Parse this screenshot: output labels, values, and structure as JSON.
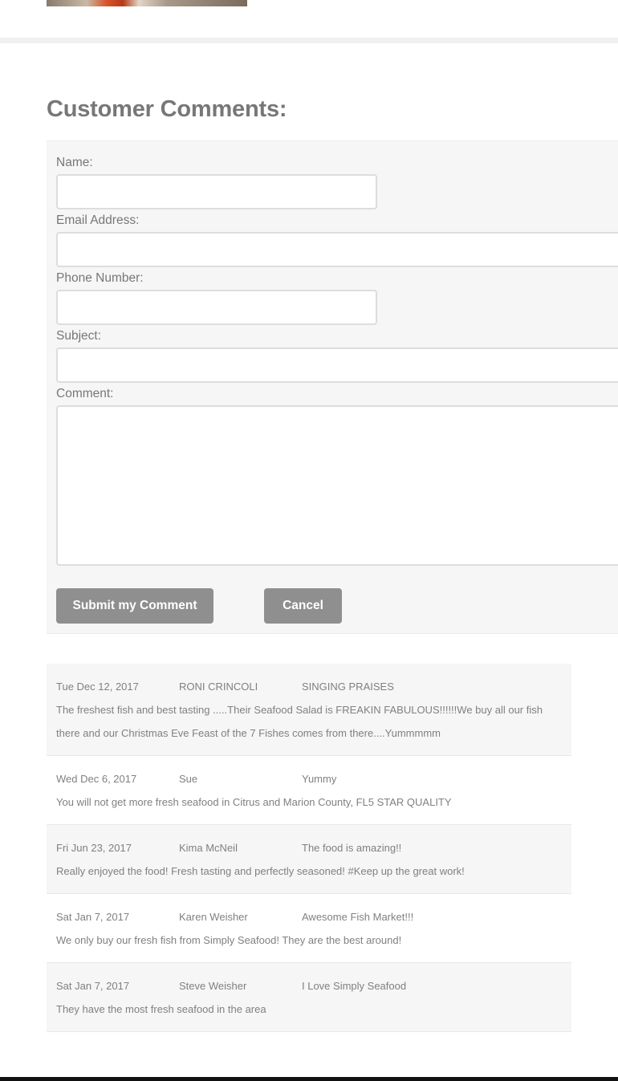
{
  "page": {
    "title": "Customer Comments:"
  },
  "form": {
    "name_label": "Name:",
    "email_label": "Email Address:",
    "phone_label": "Phone Number:",
    "subject_label": "Subject:",
    "comment_label": "Comment:",
    "name_value": "",
    "email_value": "",
    "phone_value": "",
    "subject_value": "",
    "comment_value": "",
    "submit_label": "Submit my Comment",
    "cancel_label": "Cancel"
  },
  "comments": [
    {
      "date": "Tue Dec 12, 2017",
      "name": "RONI CRINCOLI",
      "subject": "SINGING PRAISES",
      "body": "The freshest fish and best tasting .....Their Seafood Salad is FREAKIN FABULOUS!!!!!!We buy all our fish there and our Christmas Eve Feast of the 7 Fishes comes from there....Yummmmm"
    },
    {
      "date": "Wed Dec 6, 2017",
      "name": "Sue",
      "subject": "Yummy",
      "body": "You will not get more fresh seafood in Citrus and Marion County, FL5 STAR QUALITY"
    },
    {
      "date": "Fri Jun 23, 2017",
      "name": "Kima McNeil",
      "subject": "The food is amazing!!",
      "body": "Really enjoyed the food! Fresh tasting and perfectly seasoned! #Keep up the great work!"
    },
    {
      "date": "Sat Jan 7, 2017",
      "name": "Karen Weisher",
      "subject": "Awesome Fish Market!!!",
      "body": "We only buy our fresh fish from Simply Seafood! They are the best around!"
    },
    {
      "date": "Sat Jan 7, 2017",
      "name": "Steve Weisher",
      "subject": "I Love Simply Seafood",
      "body": "They have the most fresh seafood in the area"
    }
  ]
}
